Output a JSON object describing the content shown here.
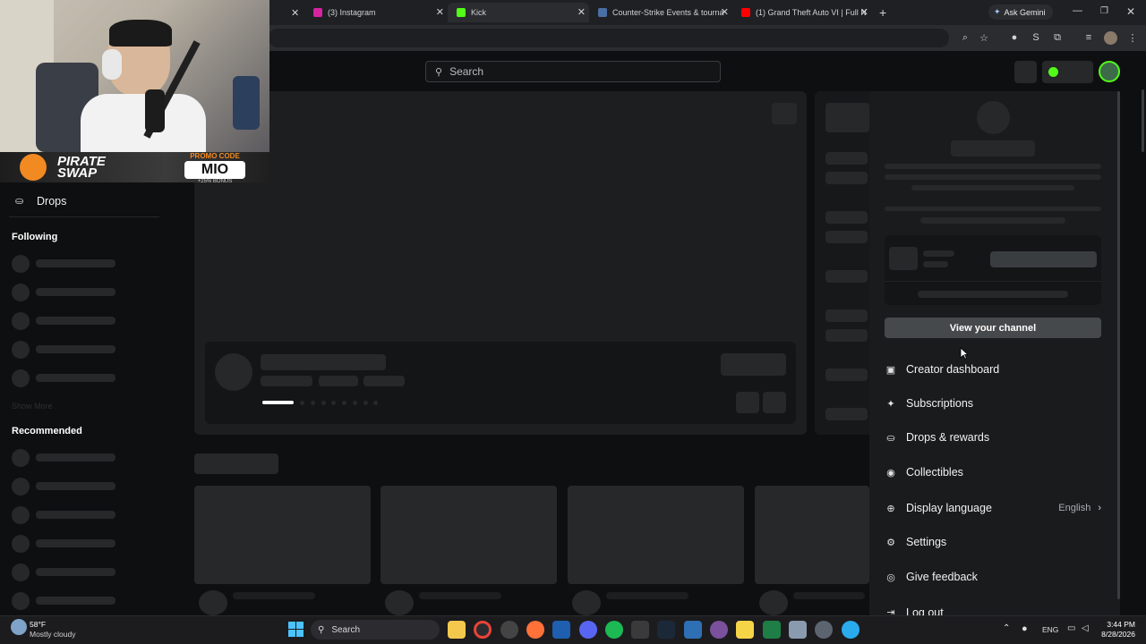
{
  "tabs": [
    {
      "title": "(3) Instagram",
      "favicon_color": "#d6249f"
    },
    {
      "title": "Kick",
      "favicon_color": "#53fc18"
    },
    {
      "title": "Counter-Strike Events & tourna",
      "favicon_color": "#4a6fa5"
    },
    {
      "title": "(1) Grand Theft Auto VI | Full N",
      "favicon_color": "#ff0000"
    }
  ],
  "ask_gemini": "Ask Gemini",
  "toolbar_letter": "S",
  "search": {
    "placeholder": "Search"
  },
  "sidebar": {
    "drops_label": "Drops",
    "following_heading": "Following",
    "show_more": "Show More",
    "recommended_heading": "Recommended"
  },
  "overlay": {
    "brand_line1": "PIRATE",
    "brand_line2": "SWAP",
    "promo_label": "PROMO CODE",
    "promo_code": "MIO",
    "bonus": "+25% BONUS"
  },
  "menu": {
    "view_channel": "View your channel",
    "items": [
      {
        "label": "Creator dashboard",
        "icon": "dashboard-icon"
      },
      {
        "label": "Subscriptions",
        "icon": "star-icon"
      },
      {
        "label": "Drops & rewards",
        "icon": "gift-icon"
      },
      {
        "label": "Collectibles",
        "icon": "collectible-icon"
      },
      {
        "label": "Display language",
        "icon": "globe-icon",
        "value": "English"
      },
      {
        "label": "Settings",
        "icon": "gear-icon"
      },
      {
        "label": "Give feedback",
        "icon": "feedback-icon"
      },
      {
        "label": "Log out",
        "icon": "logout-icon"
      }
    ]
  },
  "taskbar": {
    "weather_temp": "58°F",
    "weather_desc": "Mostly cloudy",
    "search_label": "Search",
    "language": "ENG",
    "time": "3:44 PM",
    "date": "8/28/2026"
  },
  "colors": {
    "accent": "#53fc18",
    "menu_bg": "#1a1b1d",
    "skeleton": "#26282a"
  }
}
